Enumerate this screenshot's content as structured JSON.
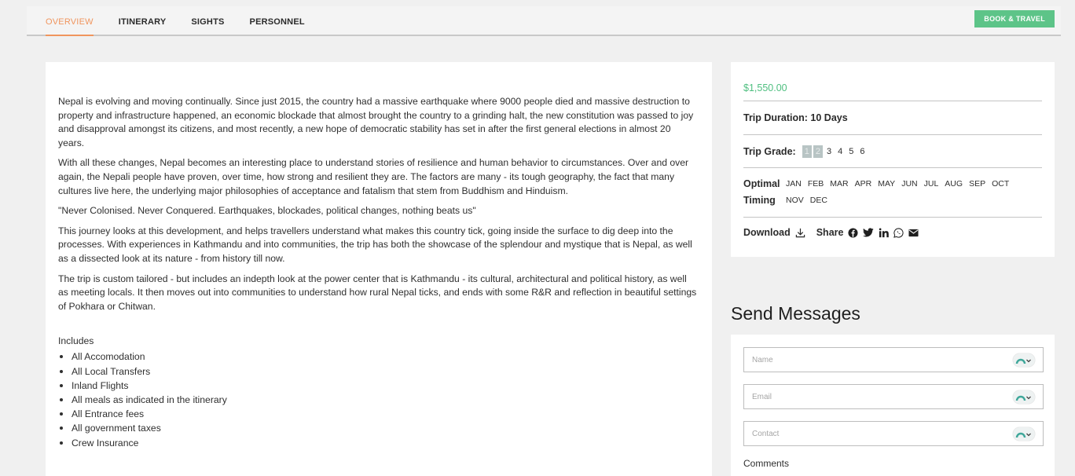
{
  "nav": {
    "tabs": [
      "OVERVIEW",
      "ITINERARY",
      "SIGHTS",
      "PERSONNEL"
    ],
    "active_tab": "OVERVIEW",
    "book_button": "BOOK & TRAVEL",
    "accent_color": "#f0955e",
    "button_color": "#5dc488"
  },
  "overview": {
    "paragraphs": [
      "Nepal is evolving and moving continually. Since just 2015, the country had a massive earthquake where 9000 people died and massive destruction to property and infrastructure happened, an economic blockade that almost brought the country to a grinding halt, the new constitution was passed to joy and disapproval amongst its citizens, and most recently, a new hope of democratic stability has set in after the first general elections in almost 20 years.",
      "With all these changes, Nepal becomes an interesting place to understand stories of resilience and human behavior to circumstances. Over and over again, the Nepali people have proven, over time, how strong and resilient they are. The factors are many - its tough geography, the fact that many cultures live here, the underlying major philosophies of acceptance and fatalism that stem from Buddhism and Hinduism.",
      "\"Never Colonised. Never Conquered. Earthquakes, blockades, political changes, nothing beats us\"",
      "This journey looks at this development, and helps travellers understand what makes this country tick, going inside the surface to dig deep into the processes. With experiences in Kathmandu and into communities, the trip has both the showcase of the splendour and mystique that is Nepal, as well as a dissected look at its nature - from history till now.",
      "The trip is custom tailored - but includes an indepth look at the power center that is Kathmandu - its cultural, architectural and political history, as well as meeting locals. It then moves out into communities to understand how rural Nepal ticks, and ends with some R&R and reflection in beautiful settings of Pokhara or Chitwan."
    ],
    "includes_title": "Includes",
    "includes": [
      "All Accomodation",
      "All Local Transfers",
      "Inland Flights",
      "All meals as indicated in the itinerary",
      "All Entrance fees",
      "All government taxes",
      "Crew Insurance"
    ]
  },
  "trip": {
    "price": "$1,550.00",
    "price_color": "#4fbf80",
    "duration": "Trip Duration: 10 Days",
    "grade_label": "Trip Grade:",
    "grades": [
      "1",
      "2",
      "3",
      "4",
      "5",
      "6"
    ],
    "highlighted_grades": [
      "1",
      "2"
    ],
    "timing_label_1": "Optimal",
    "timing_label_2": "Timing",
    "months": [
      "JAN",
      "FEB",
      "MAR",
      "APR",
      "MAY",
      "JUN",
      "JUL",
      "AUG",
      "SEP",
      "OCT",
      "NOV",
      "DEC"
    ],
    "download_label": "Download",
    "share_label": "Share",
    "share_icons": [
      "facebook-icon",
      "twitter-icon",
      "linkedin-icon",
      "whatsapp-icon",
      "mail-icon"
    ]
  },
  "contact": {
    "title": "Send Messages",
    "name_placeholder": "Name",
    "email_placeholder": "Email",
    "contact_placeholder": "Contact",
    "comments_label": "Comments"
  }
}
